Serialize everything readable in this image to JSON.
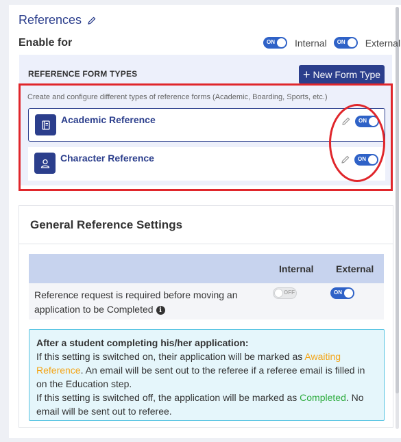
{
  "section": {
    "title": "References",
    "enable_label": "Enable for",
    "internal_label": "Internal",
    "external_label": "External",
    "toggle_on_text": "ON",
    "toggle_off_text": "OFF"
  },
  "reference_form_types": {
    "heading": "REFERENCE FORM TYPES",
    "new_button_label": "New Form Type",
    "description": "Create and configure different types of reference forms (Academic, Boarding, Sports, etc.)",
    "items": [
      {
        "name": "Academic Reference",
        "icon": "book-icon",
        "enabled": true
      },
      {
        "name": "Character Reference",
        "icon": "user-icon",
        "enabled": true
      }
    ]
  },
  "general_settings": {
    "title": "General Reference Settings",
    "col_internal": "Internal",
    "col_external": "External",
    "row_text": "Reference request is required before moving an application to be Completed",
    "row_internal": false,
    "row_external": true,
    "note": {
      "heading": "After a student completing his/her application:",
      "line1_pre": "If this setting is switched on, their application will be marked as ",
      "line1_status": "Awaiting Reference",
      "line1_post": ". An email will be sent out to the referee if a referee email is filled in on the Education step.",
      "line2_pre": "If this setting is switched off, the application will be marked as ",
      "line2_status": "Completed",
      "line2_post": ". No email will be sent out to referee."
    }
  },
  "colors": {
    "brand": "#2b3e8c",
    "toggle_on": "#2f62c7",
    "highlight": "#e0262b",
    "awaiting": "#f3a518",
    "completed": "#2eac3f"
  }
}
